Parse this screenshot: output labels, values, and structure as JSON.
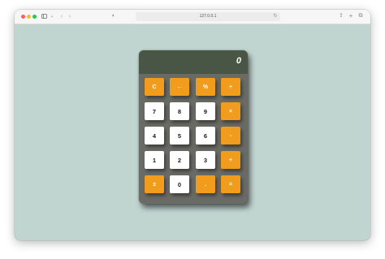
{
  "browser": {
    "address": "127.0.0.1",
    "colors": {
      "close": "#ff5f57",
      "minimize": "#febc2e",
      "maximize": "#28c840"
    }
  },
  "calculator": {
    "display": "0",
    "colors": {
      "display_bg": "#495545",
      "body": "#6b6b66",
      "operator": "#f29c1e",
      "number": "#ffffff"
    },
    "keys": [
      [
        "C",
        "←",
        "%",
        "÷"
      ],
      [
        "7",
        "8",
        "9",
        "×"
      ],
      [
        "4",
        "5",
        "6",
        "-"
      ],
      [
        "1",
        "2",
        "3",
        "+"
      ],
      [
        "±",
        "0",
        ".",
        "="
      ]
    ]
  }
}
